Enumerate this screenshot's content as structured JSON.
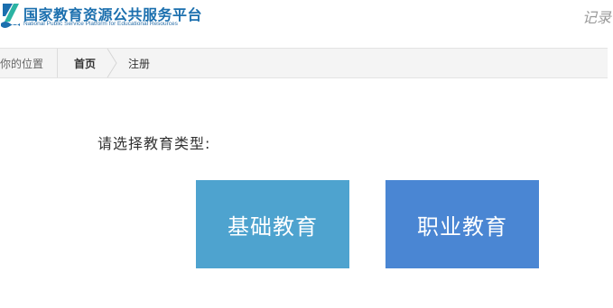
{
  "header": {
    "title": "国家教育资源公共服务平台",
    "subtitle": "National Public Service Platform for Educational Resources",
    "right_text": "记录"
  },
  "breadcrumb": {
    "location_label": "你的位置",
    "home": "首页",
    "current": "注册"
  },
  "main": {
    "prompt": "请选择教育类型:",
    "buttons": [
      {
        "label": "基础教育",
        "color": "#4ea3cf"
      },
      {
        "label": "职业教育",
        "color": "#4a86d3"
      }
    ]
  },
  "colors": {
    "brand_blue": "#1b6fae",
    "logo_teal": "#2bb3a3",
    "breadcrumb_bg": "#f4f4f4"
  }
}
